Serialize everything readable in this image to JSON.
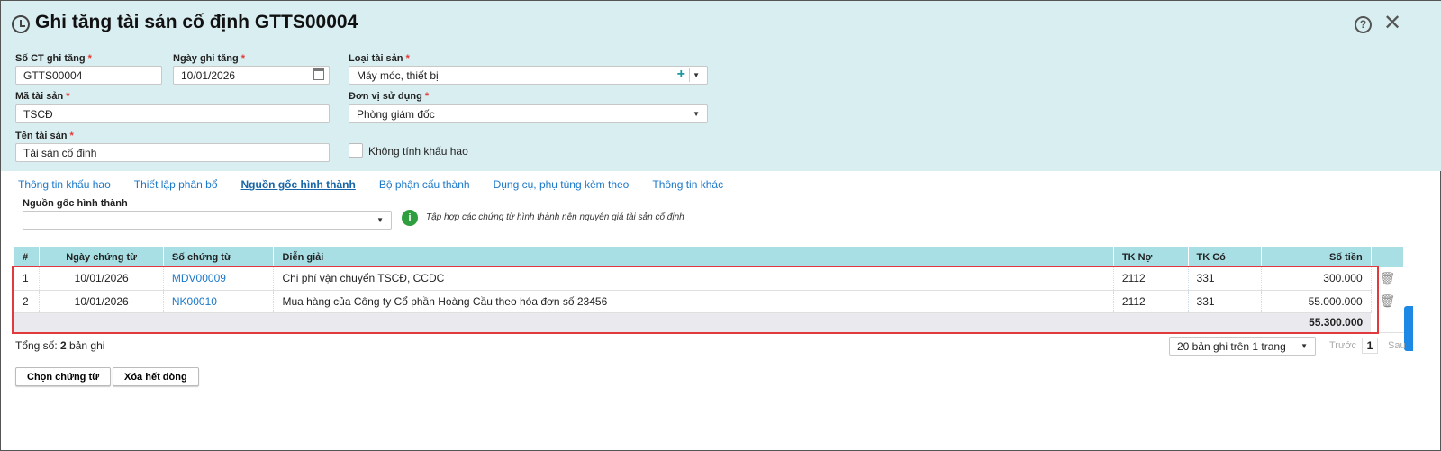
{
  "header": {
    "title": "Ghi tăng tài sản cố định GTTS00004",
    "help": "?",
    "close": "✕"
  },
  "form": {
    "so_ct": {
      "label": "Số CT ghi tăng",
      "value": "GTTS00004"
    },
    "ngay": {
      "label": "Ngày ghi tăng",
      "value": "10/01/2026"
    },
    "loai": {
      "label": "Loại tài sản",
      "value": "Máy móc, thiết bị"
    },
    "ma": {
      "label": "Mã tài sản",
      "value": "TSCĐ"
    },
    "donvi": {
      "label": "Đơn vị sử dụng",
      "value": "Phòng giám đốc"
    },
    "ten": {
      "label": "Tên tài sản",
      "value": "Tài sản cố định"
    },
    "khongtinh": {
      "label": "Không tính khấu hao"
    },
    "required": "*"
  },
  "tabs": [
    "Thông tin khấu hao",
    "Thiết lập phân bổ",
    "Nguồn gốc hình thành",
    "Bộ phận cấu thành",
    "Dụng cụ, phụ tùng kèm theo",
    "Thông tin khác"
  ],
  "nguon": {
    "label": "Nguồn gốc hình thành",
    "value": "",
    "info": "Tập hợp các chứng từ hình thành nên nguyên giá tài sản cố định"
  },
  "table": {
    "headers": [
      "#",
      "Ngày chứng từ",
      "Số chứng từ",
      "Diễn giải",
      "TK Nợ",
      "TK Có",
      "Số tiền"
    ],
    "rows": [
      [
        "1",
        "10/01/2026",
        "MDV00009",
        "Chi phí vận chuyển TSCĐ, CCDC",
        "2112",
        "331",
        "300.000"
      ],
      [
        "2",
        "10/01/2026",
        "NK00010",
        "Mua hàng của Công ty Cổ phần Hoàng Cầu theo hóa đơn số 23456",
        "2112",
        "331",
        "55.000.000"
      ]
    ],
    "total": "55.300.000"
  },
  "footer": {
    "total_prefix": "Tổng số: ",
    "total_count": "2",
    "total_suffix": " bản ghi",
    "page_size": "20 bản ghi trên 1 trang",
    "prev": "Trước",
    "page": "1",
    "next": "Sau"
  },
  "buttons": {
    "choose": "Chọn chứng từ",
    "clear": "Xóa hết dòng"
  }
}
